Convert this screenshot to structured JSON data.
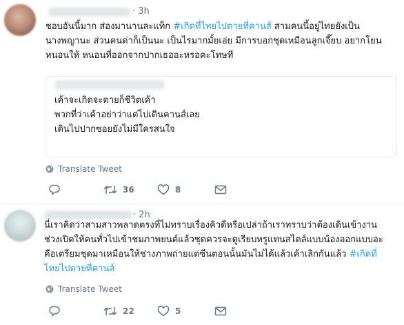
{
  "tweets": [
    {
      "time": "· 3h",
      "body": {
        "line1_pre": "ชอบอันนี้มาก ส่องมานานละแท็ก ",
        "line1_tag": "#เกิดที่ไทยไปตายที่คานส์",
        "line1_post": " สามคนนี้อยู่ไทยยังเป็น",
        "line2": "นางพญานะ ส่วนคนด่าก็เป็นนะ เป็นไรมากมั้ยเอ่ย มีการบอกชุดเหมือนลูกเจี๊ยบ อยากโยน",
        "line3": "หนอนให้ หนอนที่ออกจากปากเธออะหรอคะโทษที"
      },
      "quote": {
        "line1": "เค้าจะเกิดจะตายก็ชีวิตเค้า",
        "line2": "พวกที่ว่าเค้าอย่าว่าแต่ไปเดินคานส์เลย",
        "line3": "เดินไปปากซอยยังไม่มีใครสนใจ"
      },
      "translate_label": "Translate Tweet",
      "retweets": "36",
      "likes": "8"
    },
    {
      "time": "· 2h",
      "body": {
        "line1": "นี่เราคิดว่าสามสาวพลาดตรงที่ไม่ทราบเรื่องคิวดีหรือเปล่าถ้าเราทราบว่าต้องเดินเข้างาน",
        "line2": "ช่วงเปิดให้คนทั่วไปเข้าชมภาพยนต์แล้วชุดควรจะดูเรียบหรูแทนสไตล์แบบน้องออกแบบอะ",
        "line3_pre": "คือเตรียมชุดมาเหมือนให้ช่างภาพถ่ายแต่ซีนตอนนั้นมันไม่ได้แล้วเค้าเลิกกันแล้ว ",
        "line3_tag": "#เกิดที่",
        "line4_tag": "ไทยไปตายที่คานส์"
      },
      "translate_label": "Translate Tweet",
      "retweets": "22",
      "likes": "5"
    }
  ],
  "icons": {
    "translate": "globe-icon",
    "reply": "reply-icon",
    "retweet": "retweet-icon",
    "like": "heart-icon",
    "dm": "mail-icon"
  },
  "colors": {
    "hashtag": "#1da1f2",
    "muted": "#657786",
    "divider": "#e6ecf0"
  }
}
